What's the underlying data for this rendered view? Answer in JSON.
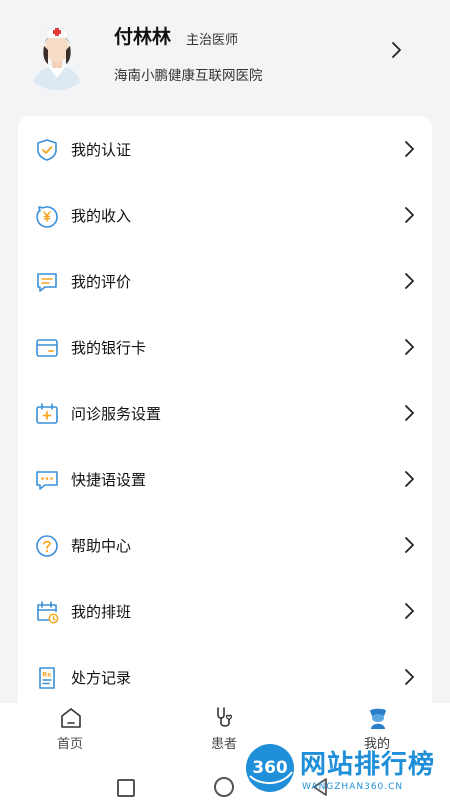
{
  "profile": {
    "name": "付林林",
    "title": "主治医师",
    "hospital": "海南小鹏健康互联网医院"
  },
  "menu": {
    "items": [
      {
        "label": "我的认证",
        "icon": "shield-check-icon"
      },
      {
        "label": "我的收入",
        "icon": "income-yen-icon"
      },
      {
        "label": "我的评价",
        "icon": "comment-icon"
      },
      {
        "label": "我的银行卡",
        "icon": "bank-card-icon"
      },
      {
        "label": "问诊服务设置",
        "icon": "consult-settings-icon"
      },
      {
        "label": "快捷语设置",
        "icon": "quick-phrase-icon"
      },
      {
        "label": "帮助中心",
        "icon": "help-icon"
      },
      {
        "label": "我的排班",
        "icon": "schedule-icon"
      },
      {
        "label": "处方记录",
        "icon": "prescription-icon"
      }
    ]
  },
  "tabbar": {
    "tabs": [
      {
        "label": "首页",
        "icon": "home-icon"
      },
      {
        "label": "患者",
        "icon": "stethoscope-icon"
      },
      {
        "label": "我的",
        "icon": "profile-icon"
      }
    ]
  },
  "watermark": {
    "logo_text": "360",
    "text": "网站排行榜",
    "url": "WANGZHAN360.CN"
  },
  "colors": {
    "accent": "#f6a623",
    "icon_blue": "#3b8fd6",
    "active_tab": "#2b7fc9",
    "watermark": "#1e8fd8"
  }
}
